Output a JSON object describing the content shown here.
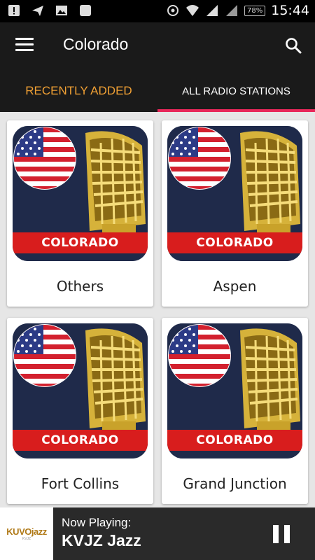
{
  "status_bar": {
    "battery": "78%",
    "time": "15:44",
    "icons": [
      "alert-icon",
      "send-icon",
      "image-icon",
      "app-icon",
      "sync-icon",
      "wifi-icon",
      "signal-icon",
      "battery-icon"
    ]
  },
  "app_bar": {
    "title": "Colorado",
    "menu_icon": "hamburger-menu-icon",
    "search_icon": "search-icon"
  },
  "tabs": [
    {
      "label": "RECENTLY ADDED",
      "selected": false
    },
    {
      "label": "ALL RADIO STATIONS",
      "selected": true
    }
  ],
  "colors": {
    "accent_tab": "#f0a034",
    "indicator": "#e8285a",
    "banner": "#d81d1d",
    "app_bar": "#1a1a1a"
  },
  "cities": [
    {
      "name": "Others",
      "banner": "COLORADO"
    },
    {
      "name": "Aspen",
      "banner": "COLORADO"
    },
    {
      "name": "Fort Collins",
      "banner": "COLORADO"
    },
    {
      "name": "Grand Junction",
      "banner": "COLORADO"
    }
  ],
  "player": {
    "logo_text": "KUVOjazz",
    "logo_sub": "KVJZ",
    "now_playing_label": "Now Playing:",
    "station": "KVJZ Jazz",
    "control_icon": "pause-icon"
  }
}
